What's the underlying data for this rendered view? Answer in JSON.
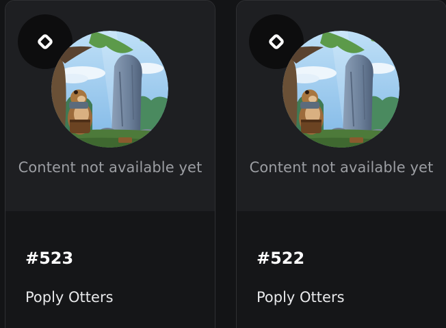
{
  "colors": {
    "page_background": "#131416",
    "card_media_background": "#1e1f22",
    "card_info_background": "#151618",
    "card_border": "#2f3033",
    "badge_background": "#0d0d0e",
    "muted_text": "#9c9ea3",
    "primary_text": "#ffffff"
  },
  "cards": [
    {
      "badge_icon": "ring-logo-icon",
      "image": "otter-beside-standing-stone",
      "status_text": "Content not available yet",
      "token_id": "#523",
      "collection": "Poply Otters"
    },
    {
      "badge_icon": "ring-logo-icon",
      "image": "otter-beside-standing-stone",
      "status_text": "Content not available yet",
      "token_id": "#522",
      "collection": "Poply Otters"
    }
  ]
}
